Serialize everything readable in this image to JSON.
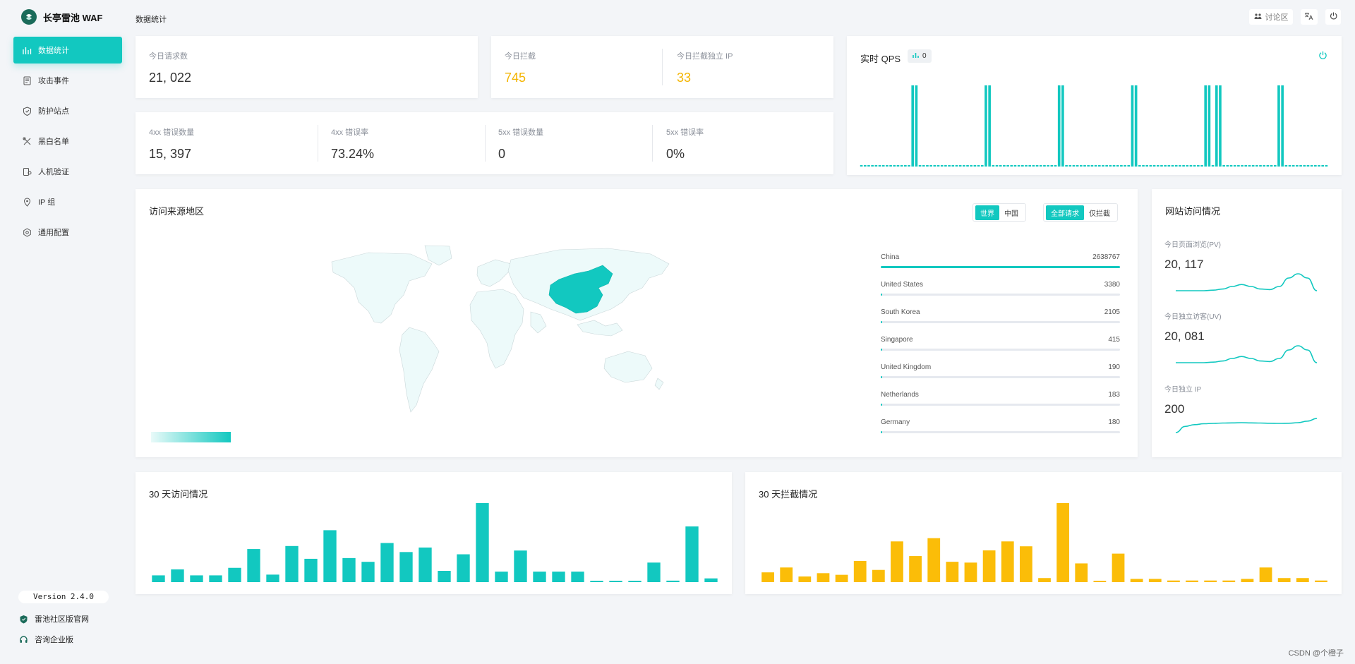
{
  "app": {
    "title": "长亭雷池 WAF",
    "page_title": "数据统计"
  },
  "sidebar": {
    "items": [
      {
        "label": "数据统计",
        "icon": "bar-chart-icon",
        "active": true
      },
      {
        "label": "攻击事件",
        "icon": "document-icon",
        "active": false
      },
      {
        "label": "防护站点",
        "icon": "shield-icon",
        "active": false
      },
      {
        "label": "黑白名单",
        "icon": "tools-icon",
        "active": false
      },
      {
        "label": "人机验证",
        "icon": "verify-icon",
        "active": false
      },
      {
        "label": "IP 组",
        "icon": "location-pin-icon",
        "active": false
      },
      {
        "label": "通用配置",
        "icon": "gear-icon",
        "active": false
      }
    ],
    "version": "Version 2.4.0",
    "community_link": "雷池社区版官网",
    "enterprise_link": "咨询企业版"
  },
  "header": {
    "forum_label": "讨论区"
  },
  "stats": {
    "requests_label": "今日请求数",
    "requests_value": "21, 022",
    "blocked_label": "今日拦截",
    "blocked_value": "745",
    "blocked_ip_label": "今日拦截独立 IP",
    "blocked_ip_value": "33",
    "e4xx_count_label": "4xx 错误数量",
    "e4xx_count_value": "15, 397",
    "e4xx_rate_label": "4xx 错误率",
    "e4xx_rate_value": "73.24%",
    "e5xx_count_label": "5xx 错误数量",
    "e5xx_count_value": "0",
    "e5xx_rate_label": "5xx 错误率",
    "e5xx_rate_value": "0%"
  },
  "qps": {
    "title": "实时 QPS",
    "current": "0",
    "accent": "#12c8c0"
  },
  "geo": {
    "title": "访问来源地区",
    "scope_options": [
      "世界",
      "中国"
    ],
    "scope_selected": "世界",
    "filter_options": [
      "全部请求",
      "仅拦截"
    ],
    "filter_selected": "全部请求",
    "highlight_color": "#12c8c0",
    "rank": [
      {
        "name": "China",
        "value": 2638767
      },
      {
        "name": "United States",
        "value": 3380
      },
      {
        "name": "South Korea",
        "value": 2105
      },
      {
        "name": "Singapore",
        "value": 415
      },
      {
        "name": "United Kingdom",
        "value": 190
      },
      {
        "name": "Netherlands",
        "value": 183
      },
      {
        "name": "Germany",
        "value": 180
      }
    ]
  },
  "site": {
    "title": "网站访问情况",
    "pv_label": "今日页面浏览(PV)",
    "pv_value": "20, 117",
    "uv_label": "今日独立访客(UV)",
    "uv_value": "20, 081",
    "ip_label": "今日独立 IP",
    "ip_value": "200"
  },
  "chart_data": [
    {
      "type": "bar",
      "title": "实时 QPS",
      "values": [
        0,
        0,
        0,
        0,
        0,
        0,
        0,
        0,
        0,
        0,
        0,
        0,
        0,
        0,
        1,
        1,
        0,
        0,
        0,
        0,
        0,
        0,
        0,
        0,
        0,
        0,
        0,
        0,
        0,
        0,
        0,
        0,
        0,
        0,
        1,
        1,
        0,
        0,
        0,
        0,
        0,
        0,
        0,
        0,
        0,
        0,
        0,
        0,
        0,
        0,
        0,
        0,
        0,
        0,
        1,
        1,
        0,
        0,
        0,
        0,
        0,
        0,
        0,
        0,
        0,
        0,
        0,
        0,
        0,
        0,
        0,
        0,
        0,
        0,
        1,
        1,
        0,
        0,
        0,
        0,
        0,
        0,
        0,
        0,
        0,
        0,
        0,
        0,
        0,
        0,
        0,
        0,
        0,
        0,
        1,
        1,
        0,
        1,
        1,
        0,
        0,
        0,
        0,
        0,
        0,
        0,
        0,
        0,
        0,
        0,
        0,
        0,
        0,
        0,
        1,
        1,
        0,
        0,
        0,
        0,
        0,
        0,
        0,
        0,
        0,
        0,
        0,
        0
      ],
      "color": "#12c8c0"
    },
    {
      "type": "bar",
      "title": "30 天访问情况",
      "values": [
        9,
        17,
        9,
        9,
        19,
        44,
        10,
        48,
        31,
        69,
        32,
        27,
        52,
        40,
        46,
        15,
        37,
        105,
        14,
        42,
        14,
        14,
        14,
        1,
        1,
        1,
        26,
        2,
        74,
        5
      ],
      "color": "#12c8c0"
    },
    {
      "type": "bar",
      "title": "30 天拦截情况",
      "values": [
        12,
        18,
        7,
        11,
        9,
        26,
        15,
        50,
        32,
        54,
        25,
        24,
        39,
        50,
        44,
        5,
        97,
        23,
        1,
        35,
        4,
        4,
        2,
        2,
        2,
        2,
        4,
        18,
        5,
        5,
        2
      ],
      "color": "#fbbd08"
    },
    {
      "type": "line",
      "title": "今日页面浏览(PV)",
      "values": [
        4,
        4,
        4,
        4,
        4.2,
        4.6,
        5.5,
        6.2,
        5.5,
        4.6,
        4.4,
        5.5,
        8.5,
        10,
        8.5,
        4
      ],
      "color": "#12c8c0"
    },
    {
      "type": "line",
      "title": "今日独立访客(UV)",
      "values": [
        4,
        4,
        4,
        4,
        4.2,
        4.6,
        5.5,
        6.2,
        5.5,
        4.6,
        4.4,
        5.5,
        8.5,
        10,
        8.5,
        4
      ],
      "color": "#12c8c0"
    },
    {
      "type": "line",
      "title": "今日独立 IP",
      "values": [
        2,
        5.5,
        6.5,
        7,
        7.2,
        7.4,
        7.5,
        7.6,
        7.5,
        7.4,
        7.3,
        7.2,
        7.3,
        7.6,
        8.5,
        10
      ],
      "color": "#12c8c0"
    }
  ],
  "footer": {
    "watermark": "CSDN @个橙子"
  }
}
